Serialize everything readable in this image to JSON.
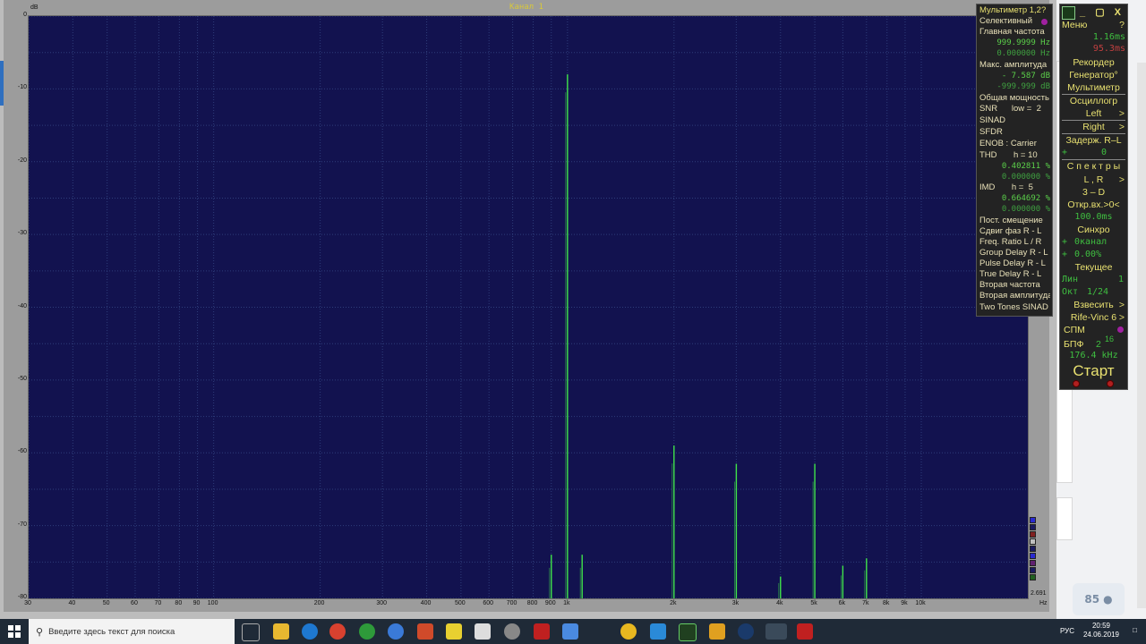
{
  "window": {
    "channel_title": "Канал 1"
  },
  "plot": {
    "y_unit": "dB",
    "x_unit": "Hz",
    "ratio_label": "2.691",
    "y_ticks": [
      "0",
      "-10",
      "-20",
      "-30",
      "-40",
      "-50",
      "-60",
      "-70",
      "-80"
    ],
    "x_ticks": [
      "30",
      "40",
      "50",
      "60",
      "70",
      "80",
      "90",
      "100",
      "200",
      "300",
      "400",
      "500",
      "600",
      "700",
      "800",
      "900",
      "1k",
      "2k",
      "3k",
      "4k",
      "5k",
      "6k",
      "7k",
      "8k",
      "9k",
      "10k"
    ]
  },
  "chart_data": {
    "type": "line",
    "title": "Канал 1",
    "xlabel": "Hz",
    "ylabel": "dB",
    "x_scale": "log",
    "xlim": [
      30,
      20000
    ],
    "ylim": [
      -80,
      0
    ],
    "grid": true,
    "series": [
      {
        "peaks": [
          {
            "x": 900,
            "y": -74
          },
          {
            "x": 1000,
            "y": -8
          },
          {
            "x": 1100,
            "y": -74
          },
          {
            "x": 2000,
            "y": -59
          },
          {
            "x": 3000,
            "y": -61.5
          },
          {
            "x": 4000,
            "y": -77
          },
          {
            "x": 5000,
            "y": -61.5
          },
          {
            "x": 6000,
            "y": -75.5
          },
          {
            "x": 7000,
            "y": -74.5
          }
        ]
      }
    ],
    "line_color": "#3fe34a"
  },
  "meter": {
    "title": "Мультиметр 1,2?",
    "selective": "Селективный",
    "main_freq_label": "Главная частота",
    "main_freq_value": "999.9999  Hz",
    "main_freq_value2": "0.000000  Hz",
    "max_amp_label": "Макс. амплитуда",
    "max_amp_value": "-   7.587 dB",
    "max_amp_value2": "-999.999 dB",
    "total_power": "Общая мощность",
    "snr": "SNR      low =  2",
    "sinad": "SINAD",
    "sfdr": "SFDR",
    "enob": "ENOB : Carrier",
    "thd": "THD       h = 10",
    "thd_value": "0.402811 %",
    "thd_value2": "0.000000 %",
    "imd": "IMD       h =  5",
    "imd_value": "0.664692 %",
    "imd_value2": "0.000000 %",
    "dc_offset": "Пост. смещение",
    "phase_shift": "Сдвиг фаз R - L",
    "freq_ratio": "Freq. Ratio  L / R",
    "group_delay": "Group Delay R - L",
    "pulse_delay": "Pulse Delay R - L",
    "true_delay": "True Delay R - L",
    "second_freq": "Вторая частота",
    "second_amp": "Вторая амплитуда",
    "two_tones": "Two Tones SINAD"
  },
  "controls": {
    "window_buttons": "_ ▢ X",
    "menu": "Меню",
    "help": "?",
    "time1": "1.16ms",
    "time2": "95.3ms",
    "recorder": "Рекордер",
    "generator": "Генератор°",
    "multimeter": "Мультиметр",
    "oscilloscope": "Осциллогр",
    "left": "Left",
    "right": "Right",
    "delay": "Задерж. R–L",
    "delay_sign": "+",
    "delay_value": "0",
    "spectra": "С п е к т р ы",
    "lr": "L , R",
    "three_d": "3 – D",
    "open_input": "Откр.вх.>0<",
    "open_input_value": "100.0ms",
    "sync": "Синхро",
    "sync_sign1": "+",
    "sync_channel": "0канал",
    "sync_sign2": "+",
    "sync_value": "0.00%",
    "current": "Текущее",
    "lin": "Лин",
    "lin_value": "1",
    "oct": "Окт",
    "oct_value": "1/24",
    "weigh": "Взвесить",
    "rife_vinc": "Rife-Vinc 6",
    "spm": "СПМ",
    "fft": "БПФ",
    "fft_base": "2",
    "fft_exp": "16",
    "sample_rate": "176.4 kHz",
    "start": "Старт"
  },
  "background": {
    "badge_count": "85"
  },
  "taskbar": {
    "search_placeholder": "Введите здесь текст для поиска",
    "lang": "РУС",
    "time": "20:59",
    "date": "24.06.2019"
  }
}
